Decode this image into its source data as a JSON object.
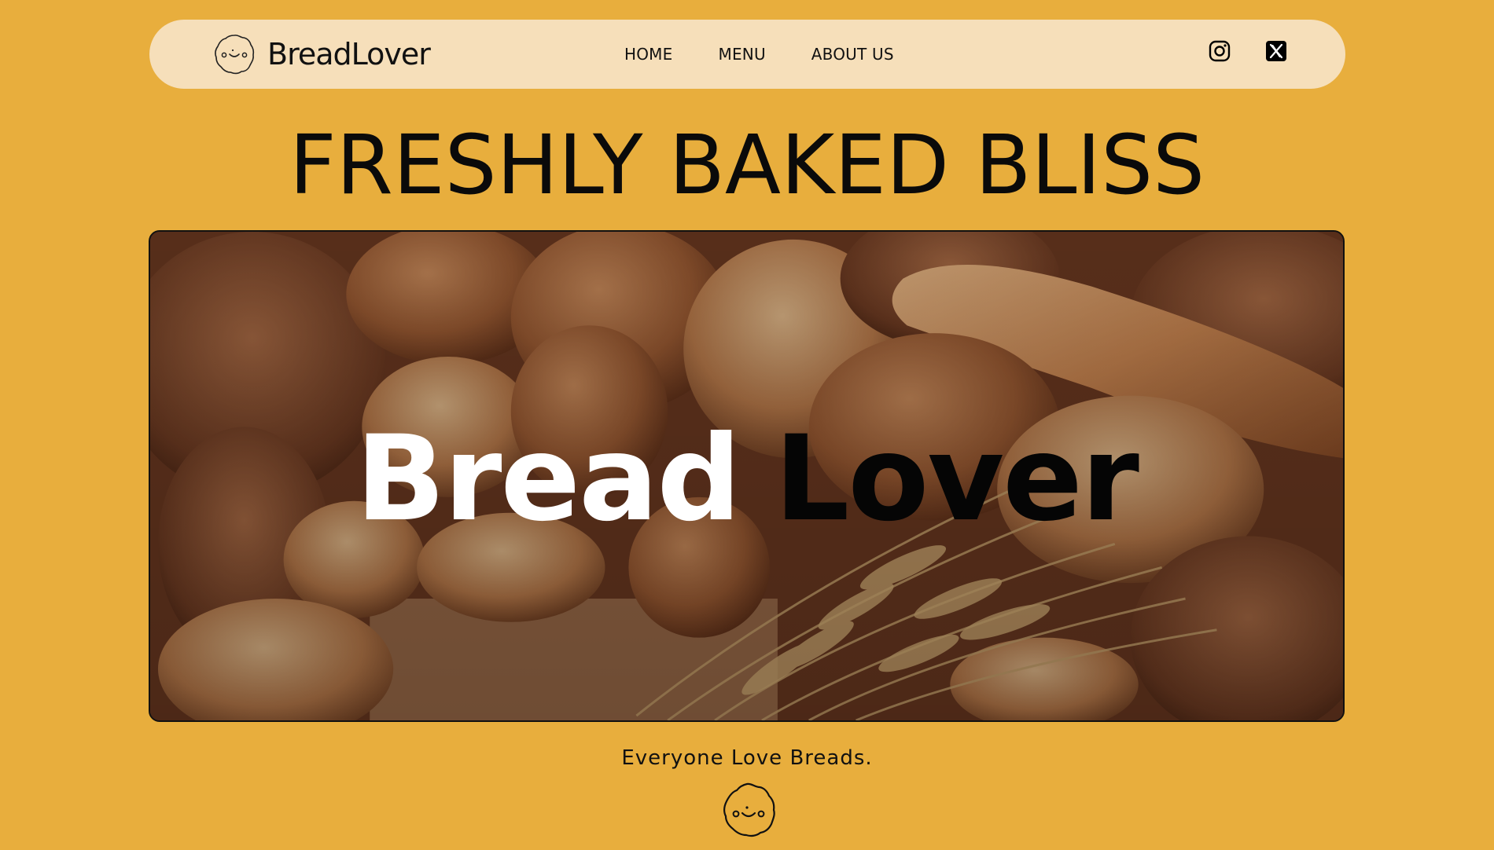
{
  "header": {
    "brand_name": "BreadLover",
    "logo_icon": "bread-face-icon",
    "nav": [
      {
        "label": "HOME"
      },
      {
        "label": "MENU"
      },
      {
        "label": "ABOUT US"
      }
    ],
    "socials": [
      {
        "icon": "instagram-icon"
      },
      {
        "icon": "x-twitter-icon"
      }
    ]
  },
  "hero": {
    "headline": "FRESHLY BAKED BLISS",
    "title_word_1": "Bread",
    "title_word_2": "Lover"
  },
  "footer": {
    "tagline": "Everyone Love Breads.",
    "logo_icon": "bread-face-icon"
  },
  "colors": {
    "page_background": "#E8AE3D",
    "navbar_background": "#F6DFBA",
    "text": "#111111",
    "hero_title_light": "#FFFFFF",
    "hero_title_dark": "#050505"
  }
}
